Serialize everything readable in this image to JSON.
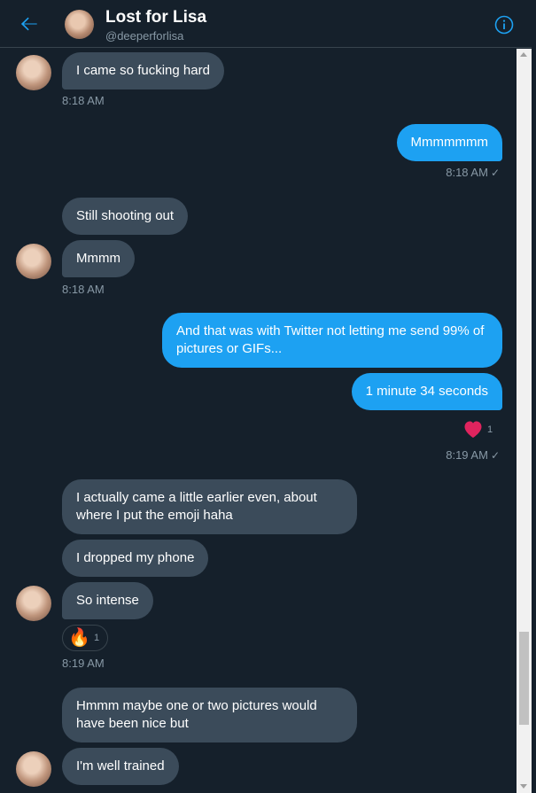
{
  "header": {
    "name": "Lost for Lisa",
    "handle": "@deeperforlisa",
    "back_icon": "arrow-left-icon",
    "info_icon": "info-icon"
  },
  "colors": {
    "background": "#15202b",
    "incoming_bubble": "#3b4b5a",
    "outgoing_bubble": "#1da1f2",
    "accent": "#1da1f2",
    "muted_text": "#8899a6",
    "heart": "#e0245e"
  },
  "messages": [
    {
      "from": "them",
      "text": "I came so fucking hard"
    },
    {
      "from": "me",
      "text": "Mmmmmmm"
    },
    {
      "from": "them",
      "text": "Still shooting out"
    },
    {
      "from": "them",
      "text": "Mmmm"
    },
    {
      "from": "me",
      "text": "And that was with Twitter not letting me send 99% of pictures or GIFs..."
    },
    {
      "from": "me",
      "text": "1 minute 34 seconds"
    },
    {
      "from": "them",
      "text": "I actually came a little earlier even, about where I put the emoji haha"
    },
    {
      "from": "them",
      "text": "I dropped my phone"
    },
    {
      "from": "them",
      "text": "So intense"
    },
    {
      "from": "them",
      "text": "Hmmm maybe one or two pictures would have been nice but"
    },
    {
      "from": "them",
      "text": "I'm well trained"
    }
  ],
  "timestamps": {
    "t1": "8:18 AM",
    "t2": "8:18 AM",
    "t3": "8:18 AM",
    "t4": "8:19 AM",
    "t5": "8:19 AM"
  },
  "reactions": {
    "heart": {
      "icon": "heart-icon",
      "count": "1"
    },
    "fire": {
      "icon": "fire-icon",
      "emoji": "🔥",
      "count": "1"
    }
  },
  "read_receipt": "✓"
}
